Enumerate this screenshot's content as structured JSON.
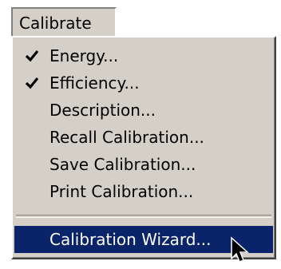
{
  "menubar": {
    "label": "Calibrate"
  },
  "menu": {
    "items": [
      {
        "label": "Energy...",
        "checked": true
      },
      {
        "label": "Efficiency...",
        "checked": true
      },
      {
        "label": "Description...",
        "checked": false
      },
      {
        "label": "Recall Calibration...",
        "checked": false
      },
      {
        "label": "Save Calibration...",
        "checked": false
      },
      {
        "label": "Print Calibration...",
        "checked": false
      }
    ],
    "highlighted_item": {
      "label": "Calibration Wizard..."
    }
  },
  "colors": {
    "menu_background": "#d4d0c8",
    "highlight_background": "#0a246a",
    "highlight_text": "#ffffff"
  },
  "icons": {
    "check": "check-icon",
    "cursor": "mouse-pointer-icon"
  }
}
